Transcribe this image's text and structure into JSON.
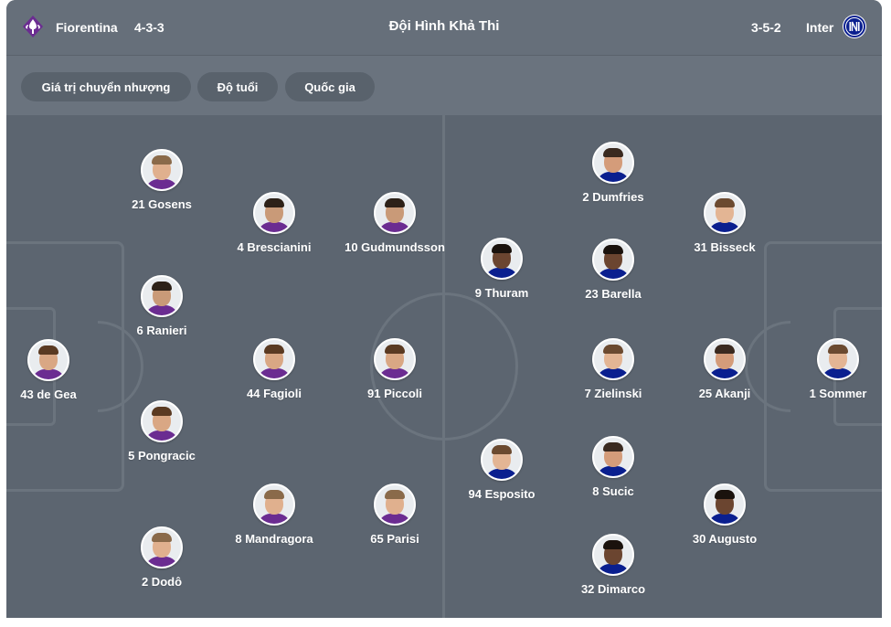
{
  "header": {
    "home_team": "Fiorentina",
    "home_formation": "4-3-3",
    "title": "Đội Hình Khả Thi",
    "away_formation": "3-5-2",
    "away_team": "Inter",
    "home_logo_icon": "fiorentina-crest-icon",
    "away_logo_icon": "inter-crest-icon"
  },
  "filters": [
    "Giá trị chuyển nhượng",
    "Độ tuổi",
    "Quốc gia"
  ],
  "colors": {
    "panel": "#5c6570",
    "header": "#666f7a",
    "pill": "#59626c",
    "fiorentina_purple": "#6b2c91",
    "inter_blue": "#0a1f8f"
  },
  "home_players": [
    {
      "label": "43 de Gea"
    },
    {
      "label": "21 Gosens"
    },
    {
      "label": "6 Ranieri"
    },
    {
      "label": "5 Pongracic"
    },
    {
      "label": "2 Dodô"
    },
    {
      "label": "4 Brescianini"
    },
    {
      "label": "44 Fagioli"
    },
    {
      "label": "8 Mandragora"
    },
    {
      "label": "10 Gudmundsson"
    },
    {
      "label": "91 Piccoli"
    },
    {
      "label": "65 Parisi"
    }
  ],
  "away_players": [
    {
      "label": "9 Thuram"
    },
    {
      "label": "94 Esposito"
    },
    {
      "label": "2 Dumfries"
    },
    {
      "label": "23 Barella"
    },
    {
      "label": "7 Zielinski"
    },
    {
      "label": "8 Sucic"
    },
    {
      "label": "32 Dimarco"
    },
    {
      "label": "31 Bisseck"
    },
    {
      "label": "25 Akanji"
    },
    {
      "label": "30 Augusto"
    },
    {
      "label": "1 Sommer"
    }
  ]
}
